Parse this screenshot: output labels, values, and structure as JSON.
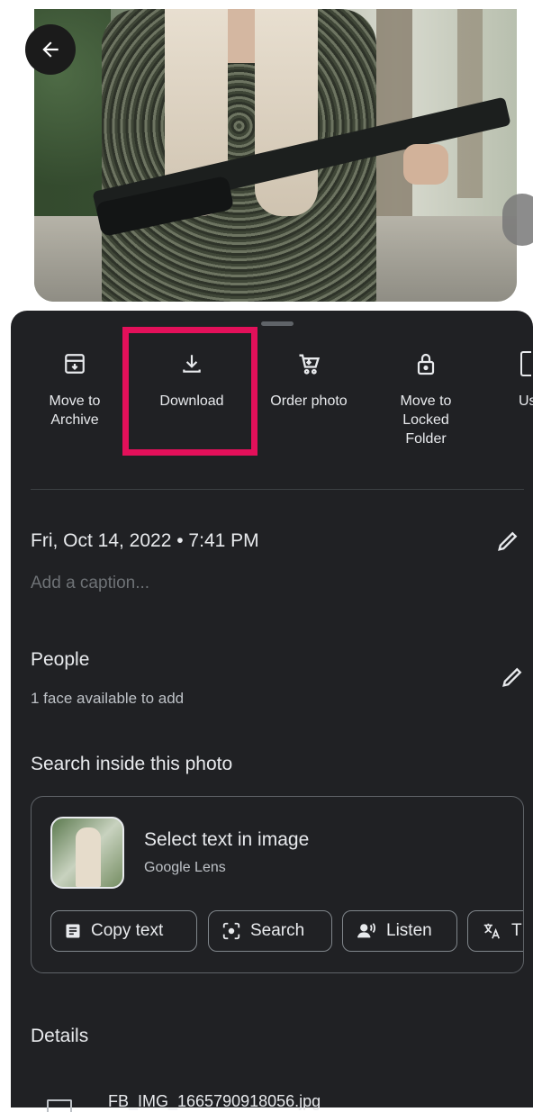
{
  "actions": [
    {
      "label": "Move to Archive",
      "icon": "archive-icon"
    },
    {
      "label": "Download",
      "icon": "download-icon"
    },
    {
      "label": "Order photo",
      "icon": "cart-icon"
    },
    {
      "label": "Move to Locked Folder",
      "icon": "lock-icon"
    },
    {
      "label": "Us",
      "icon": "more-icon"
    }
  ],
  "info": {
    "datetime": "Fri, Oct 14, 2022 • 7:41 PM",
    "caption_placeholder": "Add a caption..."
  },
  "people": {
    "title": "People",
    "subtitle": "1 face available to add"
  },
  "search_inside": {
    "title": "Search inside this photo",
    "lens_title": "Select text in image",
    "lens_subtitle": "Google Lens",
    "chips": [
      "Copy text",
      "Search",
      "Listen",
      "T"
    ]
  },
  "details": {
    "title": "Details",
    "filename": "FB_IMG_1665790918056.jpg"
  },
  "colors": {
    "sheet_bg": "#202124",
    "highlight": "#e3105a"
  }
}
